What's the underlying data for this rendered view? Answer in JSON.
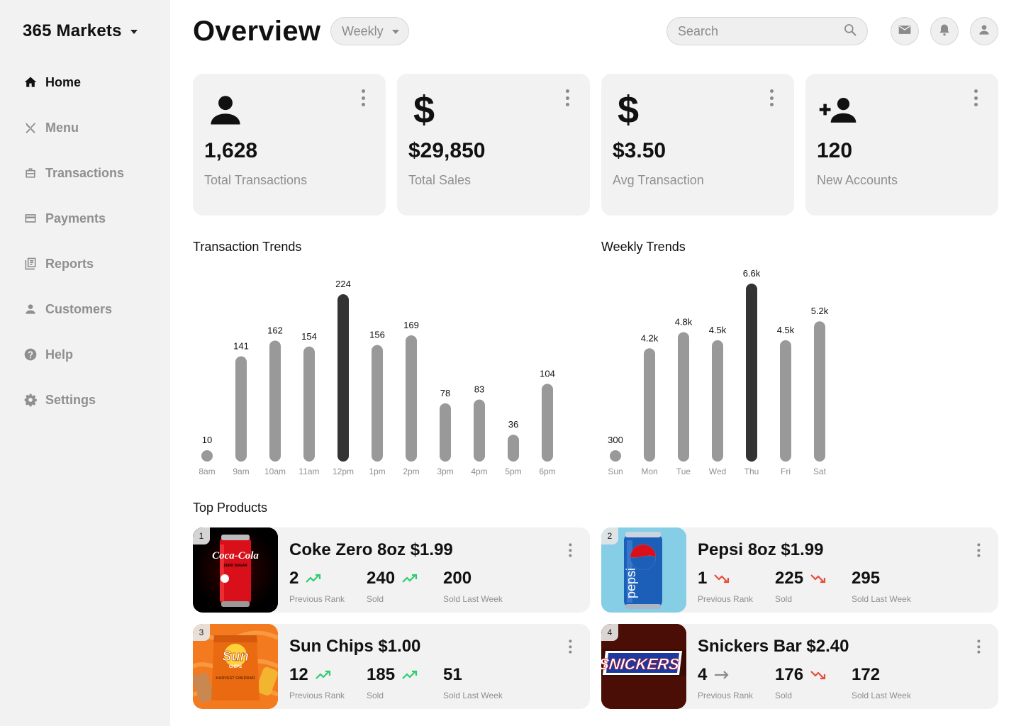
{
  "sidebar": {
    "brand": "365 Markets",
    "items": [
      {
        "label": "Home",
        "icon": "home-icon",
        "active": true
      },
      {
        "label": "Menu",
        "icon": "utensils-icon",
        "active": false
      },
      {
        "label": "Transactions",
        "icon": "briefcase-icon",
        "active": false
      },
      {
        "label": "Payments",
        "icon": "credit-card-icon",
        "active": false
      },
      {
        "label": "Reports",
        "icon": "reports-icon",
        "active": false
      },
      {
        "label": "Customers",
        "icon": "person-icon",
        "active": false
      },
      {
        "label": "Help",
        "icon": "help-icon",
        "active": false
      },
      {
        "label": "Settings",
        "icon": "gear-icon",
        "active": false
      }
    ]
  },
  "header": {
    "title": "Overview",
    "period": "Weekly",
    "search_placeholder": "Search"
  },
  "stats": [
    {
      "value": "1,628",
      "label": "Total Transactions",
      "icon": "person-icon"
    },
    {
      "value": "$29,850",
      "label": "Total Sales",
      "icon": "dollar-icon"
    },
    {
      "value": "$3.50",
      "label": "Avg Transaction",
      "icon": "dollar-icon"
    },
    {
      "value": "120",
      "label": "New Accounts",
      "icon": "add-person-icon"
    }
  ],
  "colors": {
    "bar": "#999999",
    "bar_highlight": "#333333",
    "trend_up": "#2ecc71",
    "trend_down": "#e74c3c",
    "trend_flat": "#8a8a8a"
  },
  "chart_data": [
    {
      "type": "bar",
      "title": "Transaction Trends",
      "categories": [
        "8am",
        "9am",
        "10am",
        "11am",
        "12pm",
        "1pm",
        "2pm",
        "3pm",
        "4pm",
        "5pm",
        "6pm"
      ],
      "values": [
        10,
        141,
        162,
        154,
        224,
        156,
        169,
        78,
        83,
        36,
        104
      ],
      "labels": [
        "10",
        "141",
        "162",
        "154",
        "224",
        "156",
        "169",
        "78",
        "83",
        "36",
        "104"
      ],
      "highlight_index": 4,
      "grid": false,
      "legend": "none"
    },
    {
      "type": "bar",
      "title": "Weekly Trends",
      "categories": [
        "Sun",
        "Mon",
        "Tue",
        "Wed",
        "Thu",
        "Fri",
        "Sat"
      ],
      "values": [
        300,
        4200,
        4800,
        4500,
        6600,
        4500,
        5200
      ],
      "labels": [
        "300",
        "4.2k",
        "4.8k",
        "4.5k",
        "6.6k",
        "4.5k",
        "5.2k"
      ],
      "highlight_index": 4,
      "grid": false,
      "legend": "none"
    }
  ],
  "products": {
    "title": "Top Products",
    "items": [
      {
        "rank": "1",
        "name": "Coke Zero 8oz  $1.99",
        "prev_rank": "2",
        "prev_trend": "up",
        "sold": "240",
        "sold_trend": "up",
        "last_week": "200",
        "image": "coke-zero-can-image"
      },
      {
        "rank": "2",
        "name": "Pepsi 8oz $1.99",
        "prev_rank": "1",
        "prev_trend": "down",
        "sold": "225",
        "sold_trend": "down",
        "last_week": "295",
        "image": "pepsi-can-image"
      },
      {
        "rank": "3",
        "name": "Sun Chips $1.00",
        "prev_rank": "12",
        "prev_trend": "up",
        "sold": "185",
        "sold_trend": "up",
        "last_week": "51",
        "image": "sun-chips-bag-image"
      },
      {
        "rank": "4",
        "name": "Snickers Bar $2.40",
        "prev_rank": "4",
        "prev_trend": "flat",
        "sold": "176",
        "sold_trend": "down",
        "last_week": "172",
        "image": "snickers-bar-image"
      }
    ],
    "labels": {
      "prev_rank": "Previous Rank",
      "sold": "Sold",
      "last_week": "Sold Last Week"
    }
  },
  "logos": {
    "coke": "Coca-Cola",
    "coke_sub": "ZERO SUGAR",
    "pepsi": "pepsi",
    "sunchips": "Sun",
    "sunchips_sub": "CHIPS",
    "sunchips_flavor": "HARVEST CHEDDAR",
    "snickers": "SNICKERS"
  }
}
